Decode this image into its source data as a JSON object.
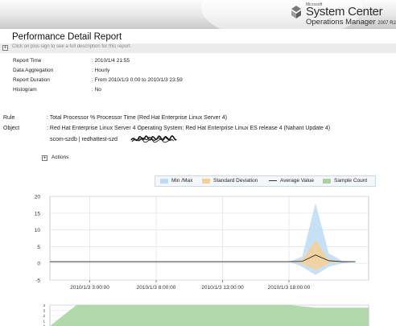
{
  "banner": {
    "microsoft": "Microsoft",
    "product": "System Center",
    "product_sub": "Operations Manager",
    "edition": "2007 R2"
  },
  "report": {
    "title": "Performance Detail Report",
    "hint": "Click on plus sign to see a full description for this report",
    "params": [
      {
        "key": "Report Time",
        "value": ": 2010/1/4 21:55"
      },
      {
        "key": "Data Aggregation",
        "value": ": Hourly"
      },
      {
        "key": "Report Duration",
        "value": ": From  2010/1/3 0:00  to  2010/1/3 23:59"
      },
      {
        "key": "Histogram",
        "value": ": No"
      }
    ],
    "rule_label": "Rule",
    "rule_value": ": Total Processor % Processor Time (Red Hat Enterprise Linux Server 4)",
    "object_label": "Object",
    "object_value": ": Red Hat Enterprise Linux Server 4 Operating System: Red Hat Enterprise Linux ES release 4 (Nahant Update 4)",
    "object_line2": "scom-szdb | redhattest-szd",
    "actions_label": "Actions"
  },
  "legend": [
    {
      "label": "Min /Max",
      "color": "#bcdcf5"
    },
    {
      "label": "Standard Deviation",
      "color": "#f7cf94"
    },
    {
      "label": "Average Value",
      "color": "#333333"
    },
    {
      "label": "Sample Count",
      "color": "#a9d4a0"
    }
  ],
  "chart_data": {
    "type": "area",
    "x_ticks": [
      "2010/1/3 3:00:00",
      "2010/1/3 8:00:00",
      "2010/1/3 13:00:00",
      "2010/1/3 18:00:00"
    ],
    "x_tick_hours": [
      3,
      8,
      13,
      18
    ],
    "xlim_hours": [
      0,
      24
    ],
    "y_ticks": [
      "20",
      "15",
      "10",
      "5",
      "0",
      "-5"
    ],
    "ylim": [
      -5,
      20
    ],
    "x_hours": [
      0,
      15,
      16,
      17,
      18,
      19,
      20,
      21,
      22,
      23
    ],
    "series": [
      {
        "name": "Min /Max",
        "upper": [
          0.5,
          0.5,
          0.5,
          0.5,
          0.5,
          2,
          18,
          3,
          0.8,
          0.5
        ],
        "lower": [
          0.5,
          0.5,
          0.5,
          0.5,
          0.5,
          -1,
          -3.5,
          -1,
          0,
          0.5
        ]
      },
      {
        "name": "Standard Deviation",
        "upper": [
          0.5,
          0.5,
          0.5,
          0.5,
          0.5,
          1,
          7,
          1,
          0.5,
          0.5
        ],
        "lower": [
          0.5,
          0.5,
          0.5,
          0.5,
          0.5,
          0,
          -2,
          0,
          0.5,
          0.5
        ]
      },
      {
        "name": "Average Value",
        "values": [
          0.5,
          0.5,
          0.5,
          0.5,
          0.5,
          0.6,
          2.5,
          0.8,
          0.5,
          0.5
        ]
      }
    ]
  },
  "sample_chart": {
    "y_ticks": [
      "4",
      "3",
      "2",
      "1",
      "0"
    ],
    "x_hours": [
      0,
      2,
      18,
      20,
      24
    ],
    "values": [
      0,
      4,
      4,
      3.5,
      3.5
    ]
  }
}
